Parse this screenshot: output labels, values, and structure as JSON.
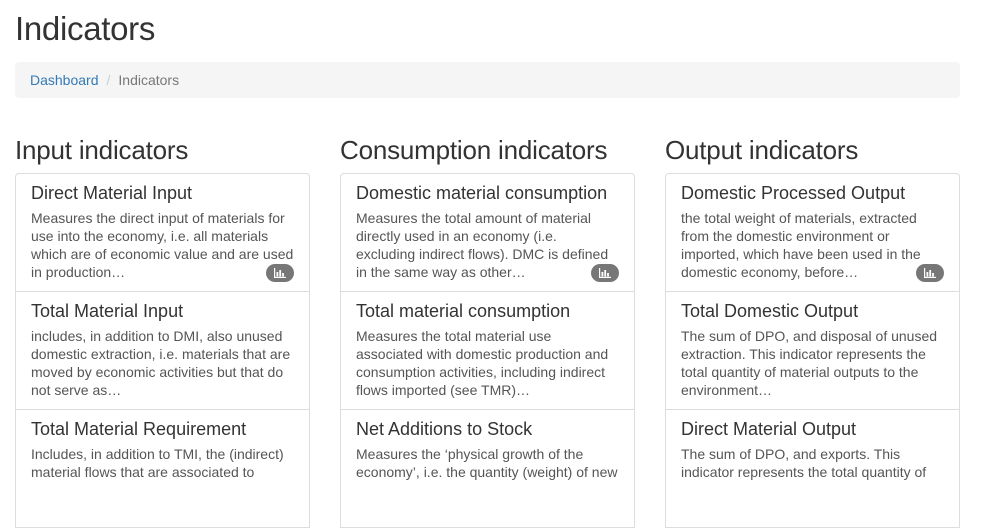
{
  "page": {
    "title": "Indicators"
  },
  "breadcrumb": {
    "home": "Dashboard",
    "separator": "/",
    "current": "Indicators"
  },
  "columns": [
    {
      "title": "Input indicators",
      "items": [
        {
          "title": "Direct Material Input",
          "text": "Measures the direct input of materials for use into the economy, i.e. all materials which are of economic value and are used in production…",
          "has_chart": true
        },
        {
          "title": "Total Material Input",
          "text": "includes, in addition to DMI, also unused domestic extraction, i.e. materials that are moved by economic activities but that do not serve as…",
          "has_chart": false
        },
        {
          "title": "Total Material Requirement",
          "text": "Includes, in addition to TMI, the (indirect) material flows that are associated to",
          "has_chart": false
        }
      ]
    },
    {
      "title": "Consumption indicators",
      "items": [
        {
          "title": "Domestic material consumption",
          "text": "Measures the total amount of material directly used in an economy (i.e. excluding indirect flows). DMC is defined in the same way as other…",
          "has_chart": true
        },
        {
          "title": "Total material consumption",
          "text": "Measures the total material use associated with domestic production and consumption activities, including indirect flows imported (see TMR)…",
          "has_chart": false
        },
        {
          "title": "Net Additions to Stock",
          "text": "Measures the ‘physical growth of the economy’, i.e. the quantity (weight) of new",
          "has_chart": false
        }
      ]
    },
    {
      "title": "Output indicators",
      "items": [
        {
          "title": "Domestic Processed Output",
          "text": "the total weight of materials, extracted from the domestic environment or imported, which have been used in the domestic economy, before…",
          "has_chart": true
        },
        {
          "title": "Total Domestic Output",
          "text": "The sum of DPO, and disposal of unused extraction. This indicator represents the total quantity of material outputs to the environment…",
          "has_chart": false
        },
        {
          "title": "Direct Material Output",
          "text": "The sum of DPO, and exports. This indicator represents the total quantity of",
          "has_chart": false
        }
      ]
    }
  ],
  "colors": {
    "link": "#337ab7",
    "badge": "#777777",
    "border": "#dddddd",
    "breadcrumb_bg": "#f5f5f5"
  },
  "icons": {
    "badge_icon": "bar-chart-icon"
  }
}
